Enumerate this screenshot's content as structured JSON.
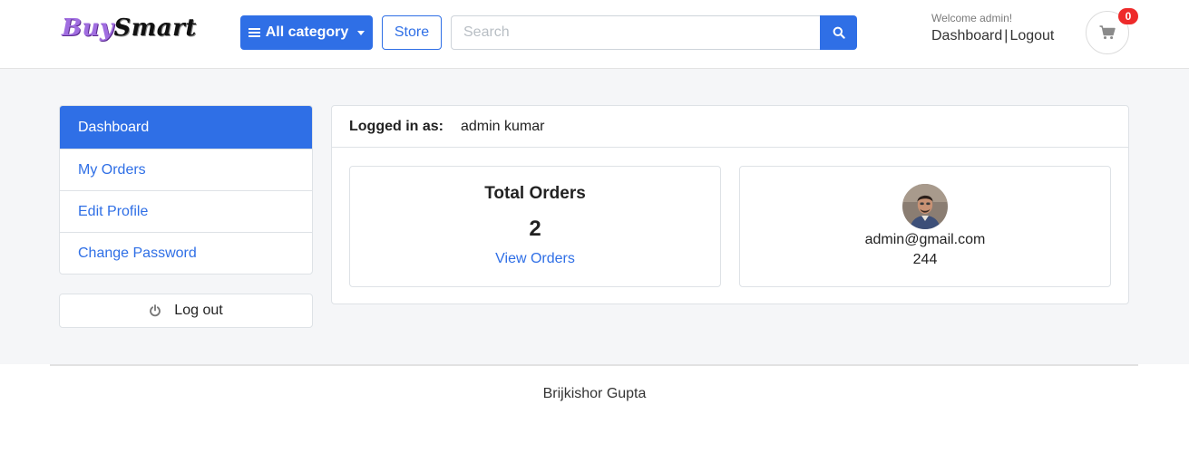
{
  "header": {
    "logo": {
      "part1": "Buy",
      "part2": "Smart"
    },
    "category_button": {
      "label": "All category",
      "icon": "bars-icon"
    },
    "store_button": {
      "label": "Store"
    },
    "search": {
      "placeholder": "Search",
      "value": "",
      "icon": "search-icon"
    },
    "welcome_text": "Welcome admin!",
    "dashboard_link": "Dashboard",
    "separator": "|",
    "logout_link": "Logout",
    "cart": {
      "icon": "cart-icon",
      "count": "0"
    }
  },
  "sidebar": {
    "items": [
      {
        "label": "Dashboard",
        "active": true
      },
      {
        "label": "My Orders",
        "active": false
      },
      {
        "label": "Edit Profile",
        "active": false
      },
      {
        "label": "Change Password",
        "active": false
      }
    ],
    "logout": {
      "label": "Log out",
      "icon": "power-icon"
    }
  },
  "panel": {
    "logged_in_label": "Logged in as:",
    "logged_in_value": "admin kumar",
    "orders_card": {
      "title": "Total Orders",
      "count": "2",
      "link": "View Orders"
    },
    "profile_card": {
      "avatar": "avatar-image",
      "email": "admin@gmail.com",
      "phone": "244"
    }
  },
  "footer": {
    "text": "Brijkishor Gupta"
  },
  "colors": {
    "primary": "#2f6fe6",
    "badge": "#ee2a2a",
    "background": "#f5f6f8",
    "logo_buy": "#a06de0"
  }
}
